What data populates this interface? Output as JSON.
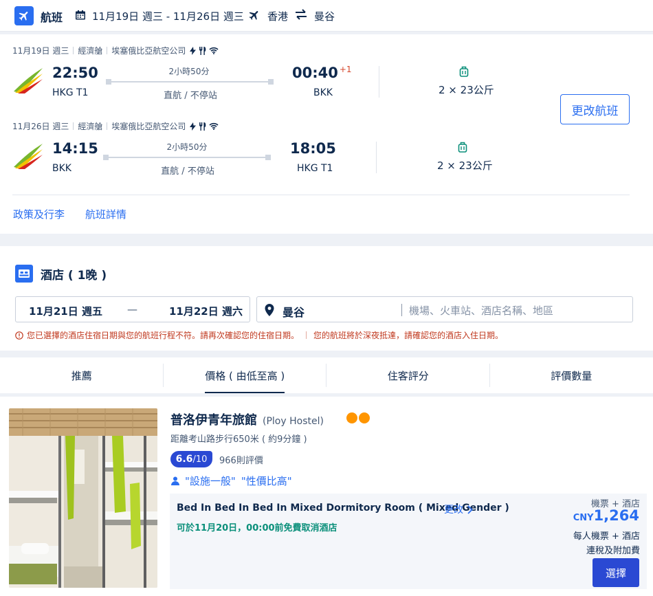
{
  "header": {
    "title": "航班",
    "dates": "11月19日 週三 - 11月26日 週三",
    "from": "香港",
    "to": "曼谷"
  },
  "flights": {
    "segments": [
      {
        "date": "11月19日 週三",
        "cabin": "經濟艙",
        "airline": "埃塞俄比亞航空公司",
        "depart_time": "22:50",
        "depart_code": "HKG T1",
        "duration": "2小時50分",
        "stops": "直航 / 不停站",
        "arrive_time": "00:40",
        "plus_day": "+1",
        "arrive_code": "BKK",
        "baggage": "2 × 23公斤"
      },
      {
        "date": "11月26日 週三",
        "cabin": "經濟艙",
        "airline": "埃塞俄比亞航空公司",
        "depart_time": "14:15",
        "depart_code": "BKK",
        "duration": "2小時50分",
        "stops": "直航 / 不停站",
        "arrive_time": "18:05",
        "plus_day": "",
        "arrive_code": "HKG T1",
        "baggage": "2 × 23公斤"
      }
    ],
    "change_button": "更改航班",
    "policy_link": "政策及行李",
    "details_link": "航班詳情"
  },
  "hotel_search": {
    "title": "酒店 ( 1晚 )",
    "checkin": "11月21日 週五",
    "dash": "—",
    "checkout": "11月22日 週六",
    "city": "曼谷",
    "placeholder": "機場、火車站、酒店名稱、地區",
    "warning_1": "您已選擇的酒店住宿日期與您的航班行程不符。請再次確認您的住宿日期。",
    "warning_2": "您的航班將於深夜抵達，請確認您的酒店入住日期。"
  },
  "sort_tabs": [
    "推薦",
    "價格 ( 由低至高 )",
    "住客評分",
    "評價數量"
  ],
  "hotel": {
    "name": "普洛伊青年旅館",
    "name_en": "(Ploy Hostel)",
    "distance": "距離考山路步行650米 ( 約9分鐘 )",
    "score": "6.6",
    "score_den": "/10",
    "reviews": "966則評價",
    "tags": [
      "\"設施一般\"",
      "\"性價比高\""
    ],
    "room_name": "Bed In Bed In Bed In Mixed Dormitory Room ( Mixed Gender )",
    "room_change": "更改",
    "cancellation": "可於11月20日，00:00前免費取消酒店",
    "package_label": "機票 + 酒店",
    "currency": "CNY",
    "price": "1,264",
    "per_person": "每人機票 + 酒店",
    "tax_note": "連稅及附加費",
    "select_button": "選擇"
  },
  "colors": {
    "brand_blue": "#2a6ef0",
    "score_blue": "#2a49d3",
    "warning_red": "#c0391f",
    "cancel_green": "#0a8f7a",
    "star_orange": "#ff9500"
  }
}
